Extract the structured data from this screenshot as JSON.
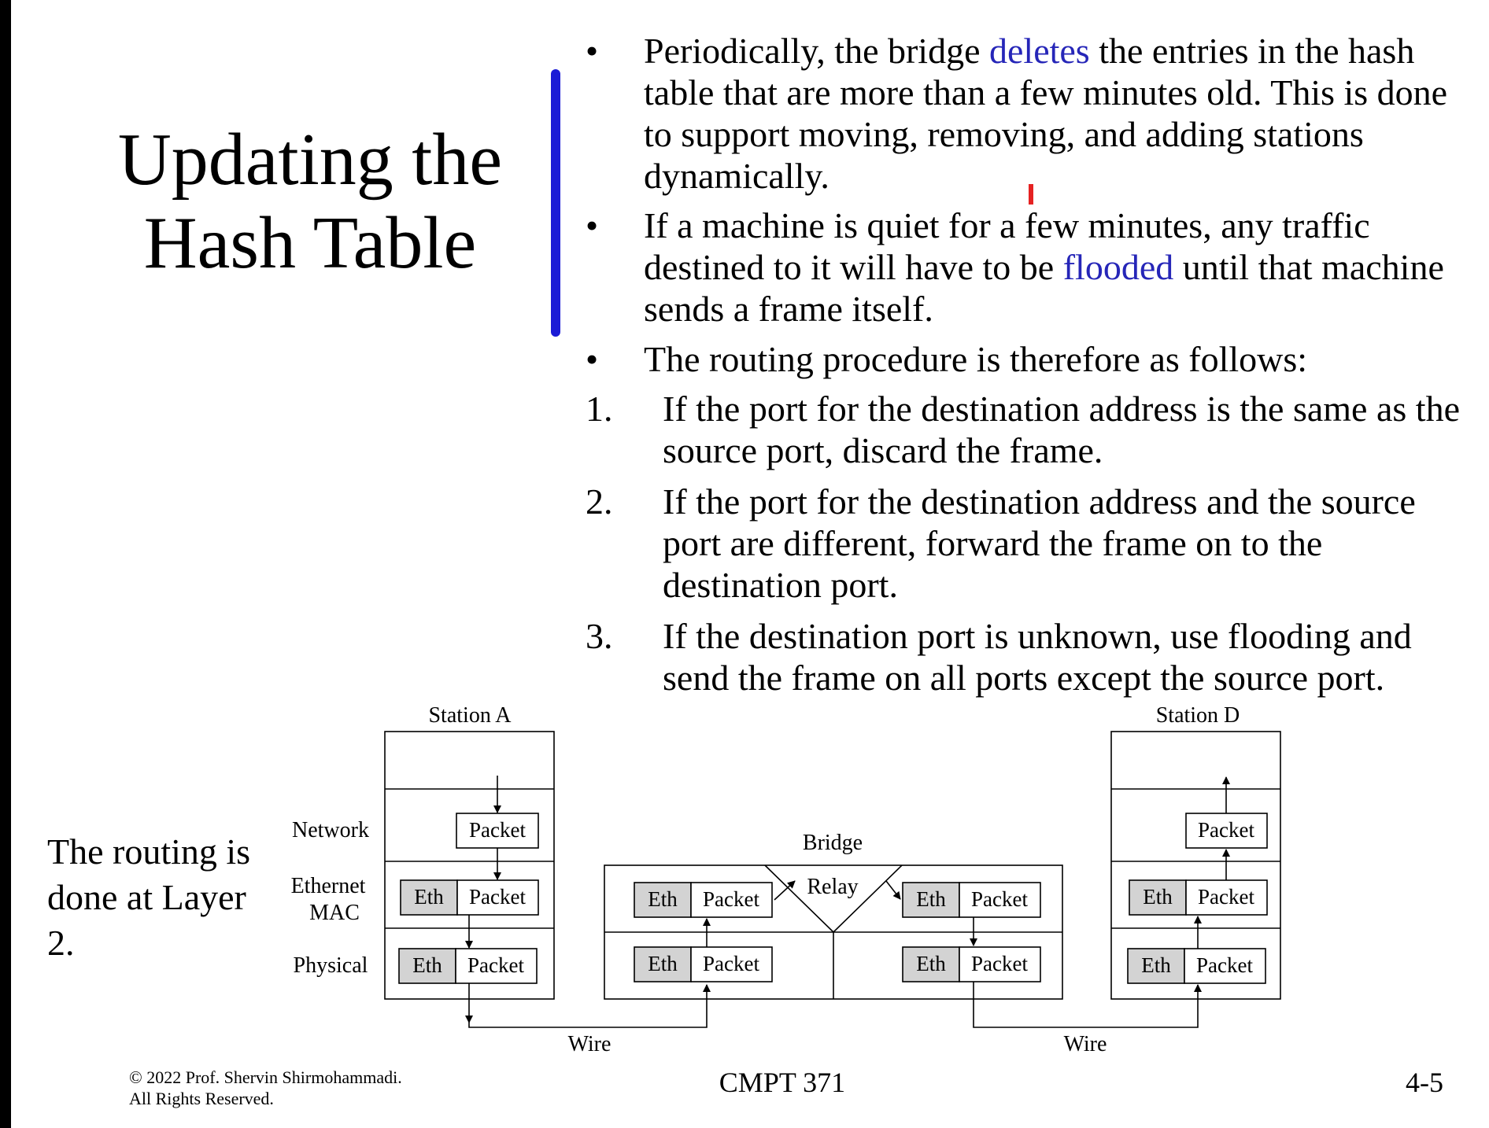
{
  "title_line1": "Updating the",
  "title_line2": "Hash Table",
  "bullets": [
    {
      "marker": "•",
      "before": "Periodically, the bridge ",
      "highlight": "deletes",
      "after": " the entries in the hash table that are more than a few minutes old. This is done to support moving, removing, and adding stations dynamically."
    },
    {
      "marker": "•",
      "before": "If a machine is quiet for a few minutes, any traffic destined to it will have to be ",
      "highlight": "flooded",
      "after": " until that machine sends a frame itself."
    },
    {
      "marker": "•",
      "text": "The routing procedure is therefore as follows:"
    }
  ],
  "steps": [
    {
      "num": "1.",
      "text": "If the port for the destination address is the same as the source port, discard the frame."
    },
    {
      "num": "2.",
      "text": "If the port for the destination address and the source port are different, forward the frame on to the destination port."
    },
    {
      "num": "3.",
      "text": "If the destination port is unknown, use flooding and send the frame on all ports except the source port."
    }
  ],
  "side_note": "The routing is done at Layer 2.",
  "diagram": {
    "station_a": "Station  A",
    "station_d": "Station  D",
    "bridge": "Bridge",
    "relay": "Relay",
    "layer_network": "Network",
    "layer_ethernet_1": "Ethernet",
    "layer_ethernet_2": "MAC",
    "layer_physical": "Physical",
    "eth": "Eth",
    "packet": "Packet",
    "wire": "Wire"
  },
  "footer": {
    "copyright_1": "© 2022 Prof. Shervin Shirmohammadi.",
    "copyright_2": "All Rights Reserved.",
    "course": "CMPT 371",
    "page": "4-5"
  },
  "colors": {
    "highlight": "#2626b8",
    "pen_blue": "#1b1bd6",
    "pen_red": "#e52222",
    "eth_fill": "#d3d3d3"
  }
}
